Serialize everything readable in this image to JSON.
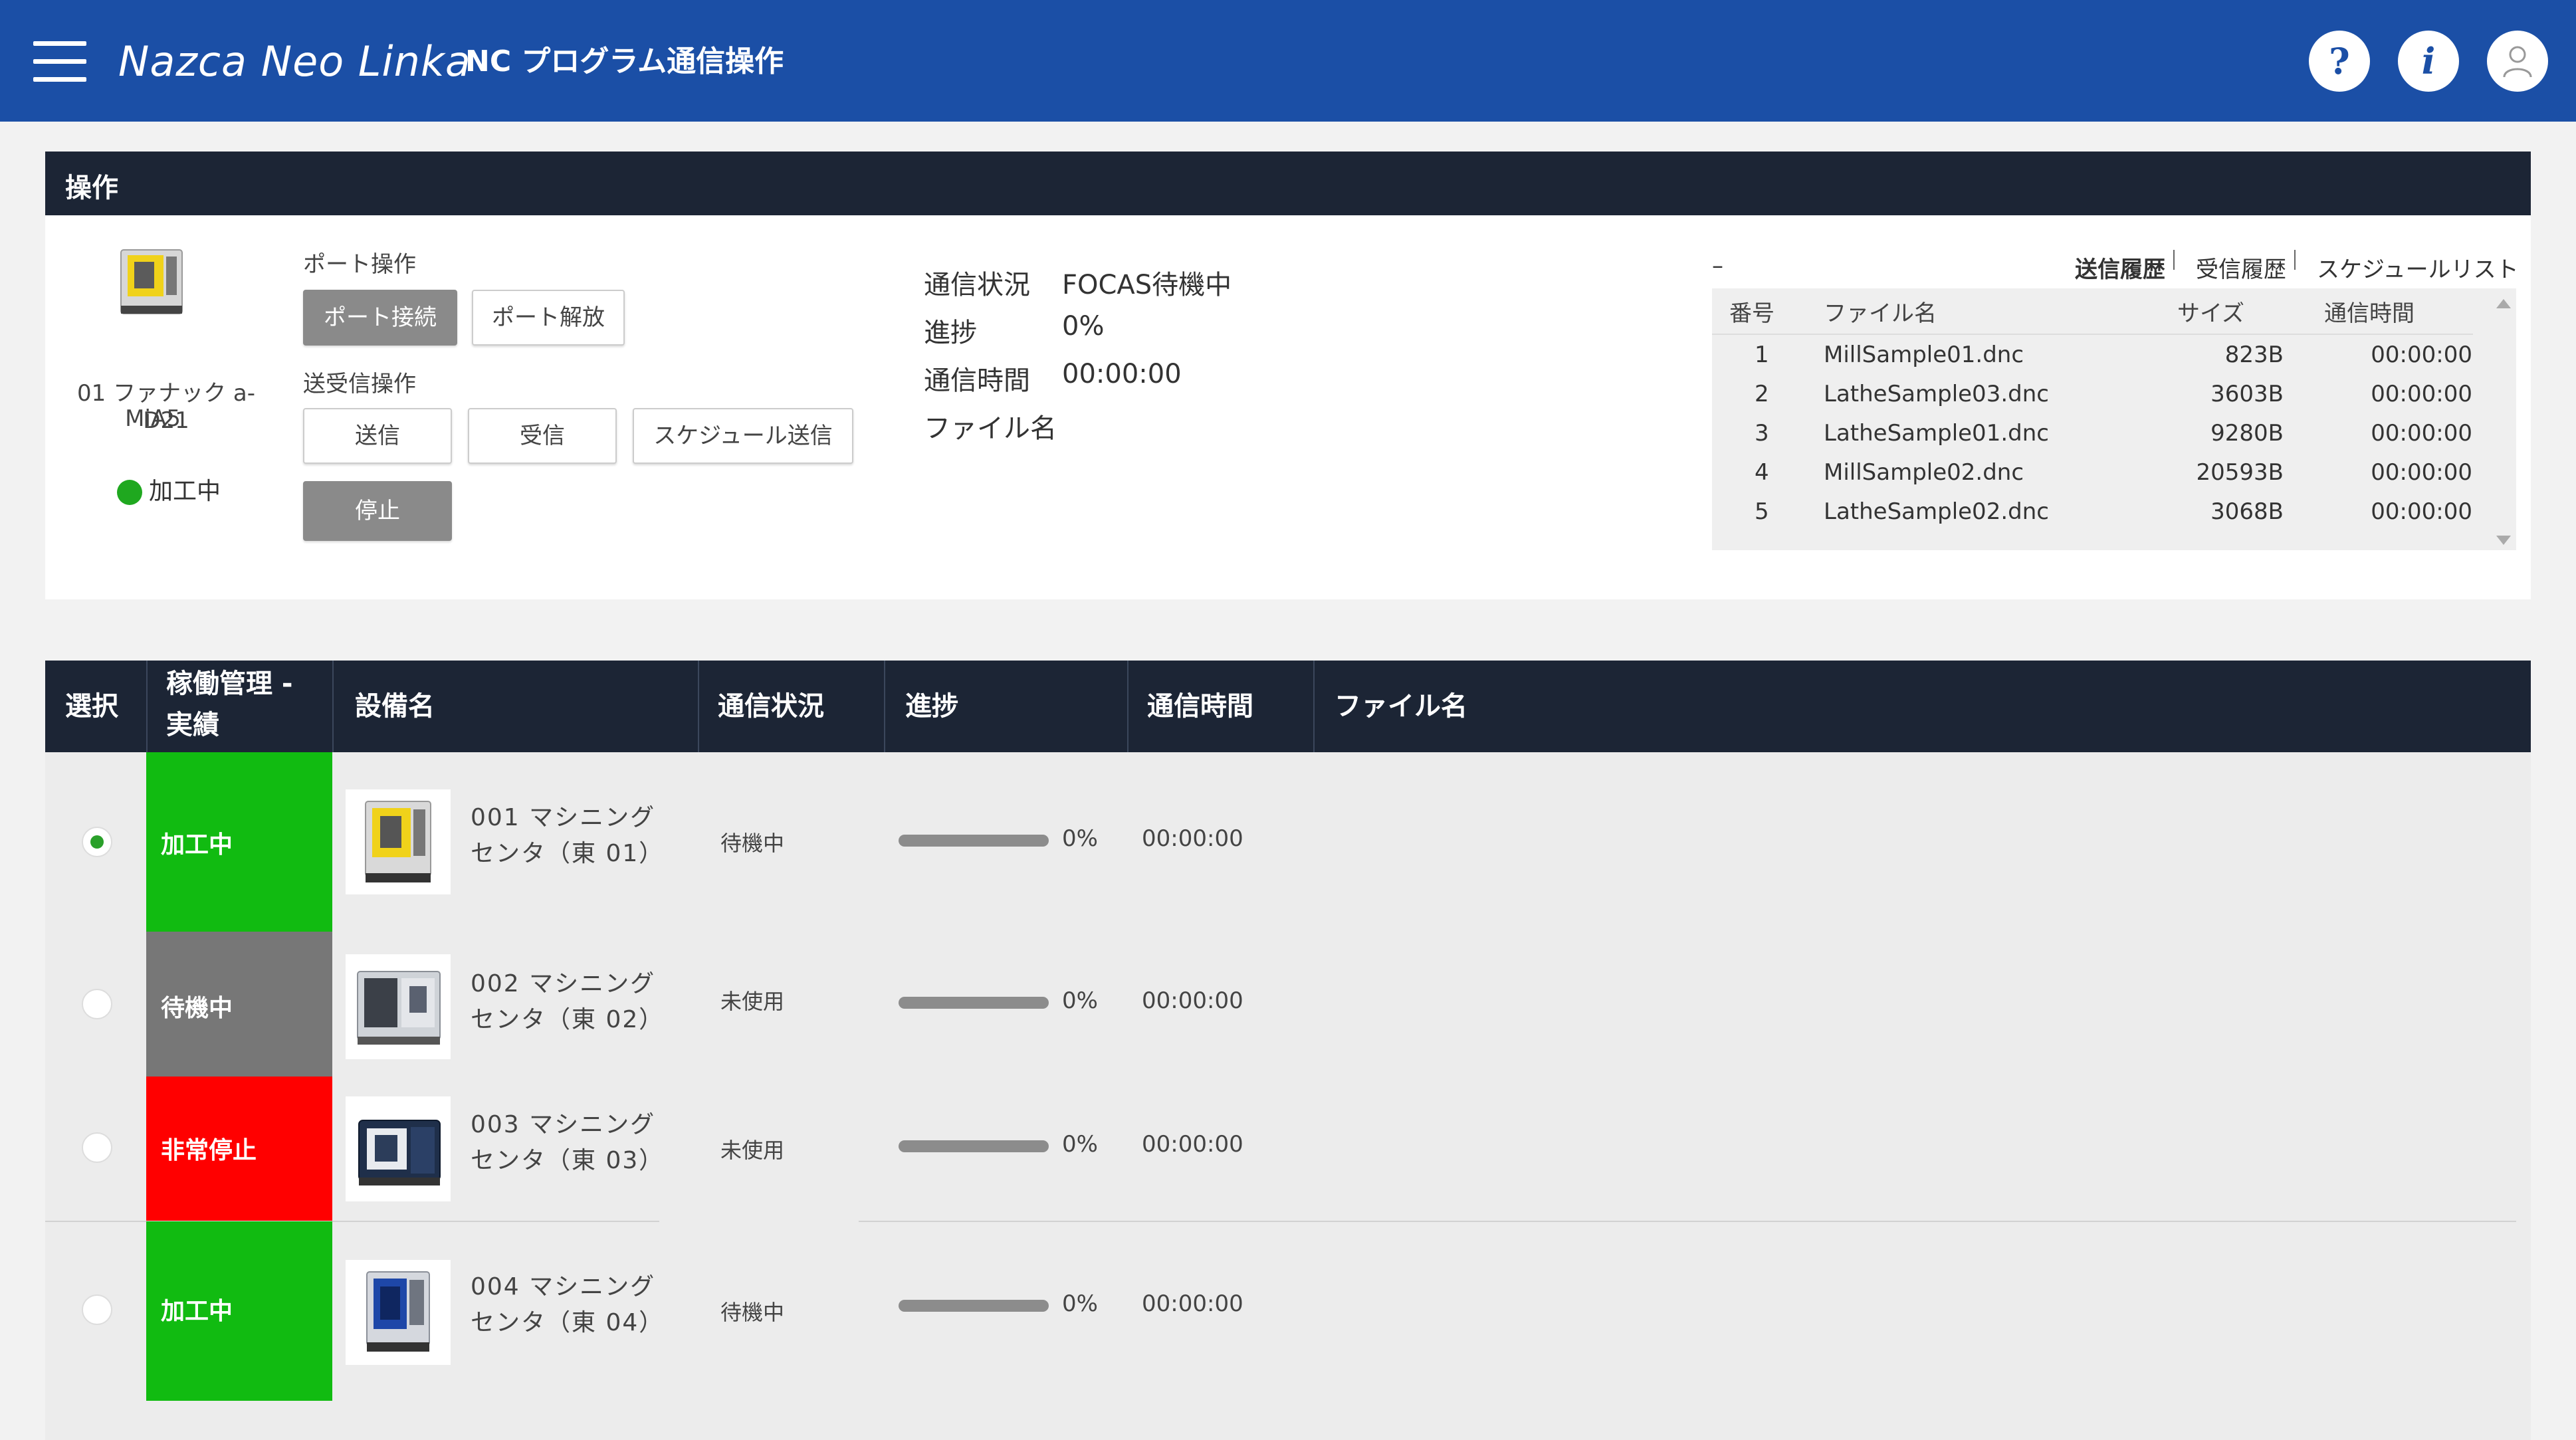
{
  "header": {
    "brand": "Nazca Neo Linka",
    "title": "NC プログラム通信操作",
    "help_label": "?",
    "info_label": "i"
  },
  "operation": {
    "panel_title": "操作",
    "machine_name": "01 ファナック a-D21",
    "machine_model": "MiA5",
    "machine_state": "加工中",
    "port_ops_label": "ポート操作",
    "port_connect": "ポート接続",
    "port_release": "ポート解放",
    "txrx_ops_label": "送受信操作",
    "send": "送信",
    "receive": "受信",
    "schedule_send": "スケジュール送信",
    "stop": "停止",
    "status_key": "通信状況",
    "status_val": "FOCAS待機中",
    "progress_key": "進捗",
    "progress_val": "0%",
    "time_key": "通信時間",
    "time_val": "00:00:00",
    "file_key": "ファイル名",
    "dash": "–"
  },
  "history": {
    "tabs": [
      "送信履歴",
      "受信履歴",
      "スケジュールリスト"
    ],
    "active_tab": 0,
    "columns": [
      "番号",
      "ファイル名",
      "サイズ",
      "通信時間"
    ],
    "rows": [
      {
        "no": "1",
        "file": "MillSample01.dnc",
        "size": "823B",
        "time": "00:00:00"
      },
      {
        "no": "2",
        "file": "LatheSample03.dnc",
        "size": "3603B",
        "time": "00:00:00"
      },
      {
        "no": "3",
        "file": "LatheSample01.dnc",
        "size": "9280B",
        "time": "00:00:00"
      },
      {
        "no": "4",
        "file": "MillSample02.dnc",
        "size": "20593B",
        "time": "00:00:00"
      },
      {
        "no": "5",
        "file": "LatheSample02.dnc",
        "size": "3068B",
        "time": "00:00:00"
      }
    ]
  },
  "equipment_table": {
    "columns": {
      "select": "選択",
      "status_mgmt_1": "稼働管理 -",
      "status_mgmt_2": "実績",
      "name": "設備名",
      "comm": "通信状況",
      "progress": "進捗",
      "time": "通信時間",
      "file": "ファイル名"
    },
    "rows": [
      {
        "selected": true,
        "state": "加工中",
        "state_color": "#11bb11",
        "name1": "001 マシニング",
        "name2": "センタ（東 01）",
        "comm": "待機中",
        "progress_pct": 0,
        "progress": "0%",
        "time": "00:00:00"
      },
      {
        "selected": false,
        "state": "待機中",
        "state_color": "#777777",
        "name1": "002 マシニング",
        "name2": "センタ（東 02）",
        "comm": "未使用",
        "progress_pct": 0,
        "progress": "0%",
        "time": "00:00:00"
      },
      {
        "selected": false,
        "state": "非常停止",
        "state_color": "#ff0000",
        "name1": "003 マシニング",
        "name2": "センタ（東 03）",
        "comm": "未使用",
        "progress_pct": 0,
        "progress": "0%",
        "time": "00:00:00"
      },
      {
        "selected": false,
        "state": "加工中",
        "state_color": "#11bb11",
        "name1": "004 マシニング",
        "name2": "センタ（東 04）",
        "comm": "待機中",
        "progress_pct": 0,
        "progress": "0%",
        "time": "00:00:00"
      }
    ]
  },
  "colors": {
    "header_bg": "#1b4fa6",
    "panel_header_bg": "#1c2535",
    "running": "#11bb11",
    "idle": "#777777",
    "emergency": "#ff0000"
  }
}
